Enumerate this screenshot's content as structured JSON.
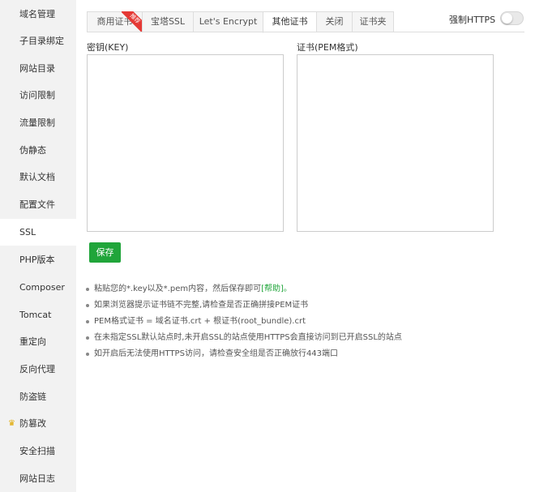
{
  "sidebar": {
    "items": [
      {
        "label": "域名管理"
      },
      {
        "label": "子目录绑定"
      },
      {
        "label": "网站目录"
      },
      {
        "label": "访问限制"
      },
      {
        "label": "流量限制"
      },
      {
        "label": "伪静态"
      },
      {
        "label": "默认文档"
      },
      {
        "label": "配置文件"
      },
      {
        "label": "SSL"
      },
      {
        "label": "PHP版本"
      },
      {
        "label": "Composer"
      },
      {
        "label": "Tomcat"
      },
      {
        "label": "重定向"
      },
      {
        "label": "反向代理"
      },
      {
        "label": "防盗链"
      },
      {
        "label": "防篡改",
        "icon": "crown-icon"
      },
      {
        "label": "安全扫描"
      },
      {
        "label": "网站日志"
      }
    ],
    "active_index": 8
  },
  "tabs": {
    "items": [
      {
        "label": "商用证书",
        "badge": "推荐"
      },
      {
        "label": "宝塔SSL"
      },
      {
        "label": "Let's Encrypt"
      },
      {
        "label": "其他证书"
      },
      {
        "label": "关闭"
      },
      {
        "label": "证书夹"
      }
    ],
    "active_index": 3
  },
  "force_https": {
    "label": "强制HTTPS",
    "enabled": false
  },
  "form": {
    "key_label": "密钥(KEY)",
    "key_value": "",
    "cert_label": "证书(PEM格式)",
    "cert_value": "",
    "save_label": "保存"
  },
  "tips": {
    "items": [
      {
        "text": "粘贴您的*.key以及*.pem内容，然后保存即可",
        "link": "[帮助]。"
      },
      {
        "text": "如果浏览器提示证书链不完整,请检查是否正确拼接PEM证书"
      },
      {
        "text": "PEM格式证书 = 域名证书.crt + 根证书(root_bundle).crt"
      },
      {
        "text": "在未指定SSL默认站点时,未开启SSL的站点使用HTTPS会直接访问到已开启SSL的站点"
      },
      {
        "text": "如开启后无法使用HTTPS访问，请检查安全组是否正确放行443端口"
      }
    ]
  },
  "colors": {
    "accent": "#20a53a",
    "badge": "#e53935",
    "sidebar_bg": "#f2f2f2"
  }
}
